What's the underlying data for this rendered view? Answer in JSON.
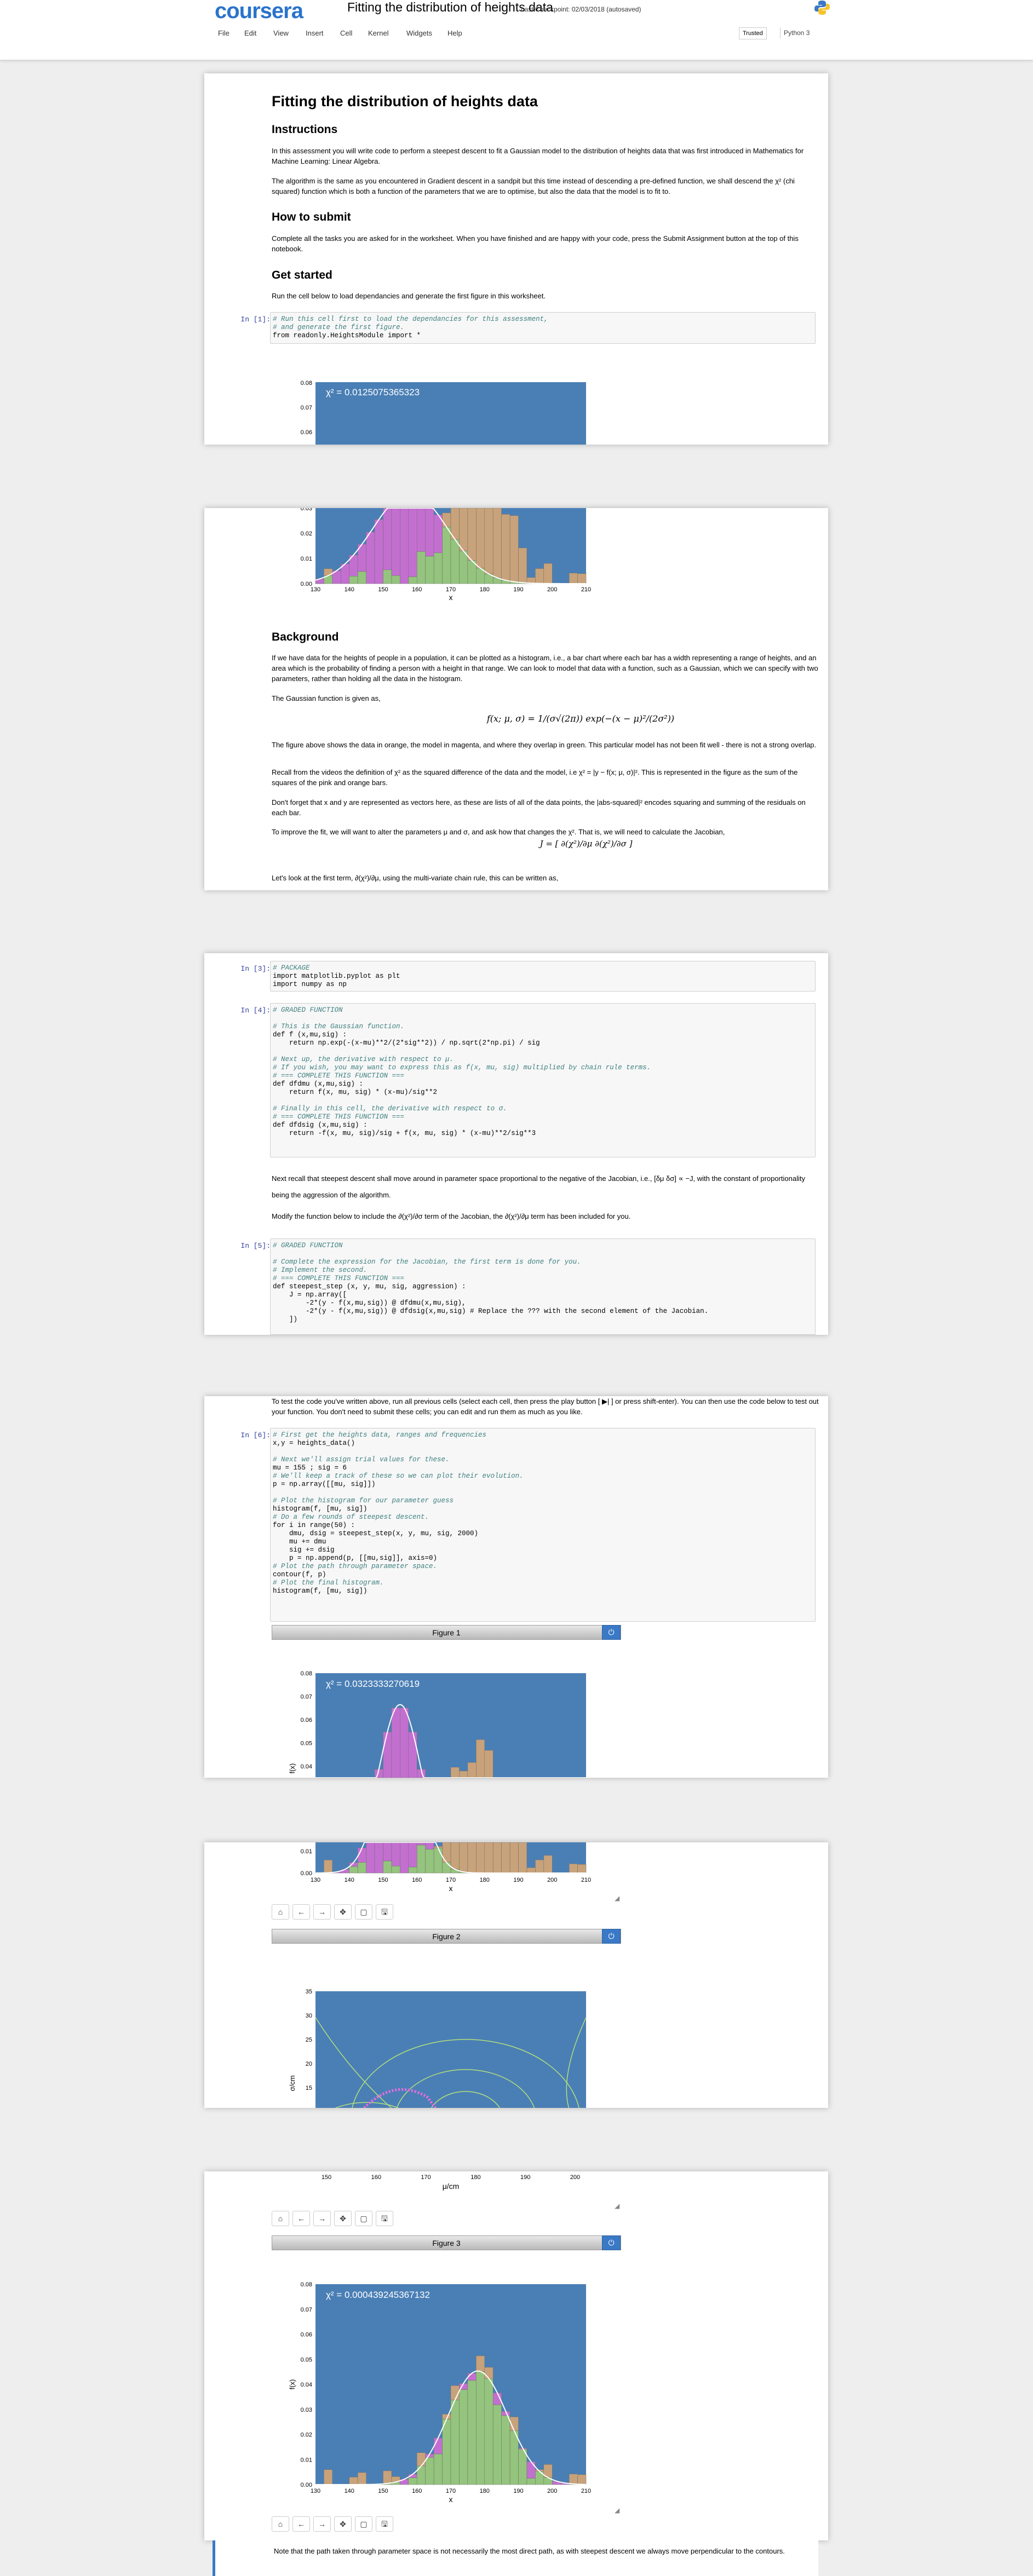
{
  "header": {
    "logo": "coursera",
    "notebook_title": "Fitting the distribution of heights data",
    "checkpoint": "Last Checkpoint: 02/03/2018 (autosaved)",
    "menu": [
      "File",
      "Edit",
      "View",
      "Insert",
      "Cell",
      "Kernel",
      "Widgets",
      "Help"
    ],
    "trusted": "Trusted",
    "kernel": "Python 3"
  },
  "intro": {
    "title": "Fitting the distribution of heights data",
    "h_instructions": "Instructions",
    "p1": "In this assessment you will write code to perform a steepest descent to fit a Gaussian model to the distribution of heights data that was first introduced in Mathematics for Machine Learning: Linear Algebra.",
    "p2": "The algorithm is the same as you encountered in Gradient descent in a sandpit but this time instead of descending a pre-defined function, we shall descend the χ² (chi squared) function which is both a function of the parameters that we are to optimise, but also the data that the model is to fit to.",
    "h_submit": "How to submit",
    "p3": "Complete all the tasks you are asked for in the worksheet. When you have finished and are happy with your code, press the Submit Assignment button at the top of this notebook.",
    "h_started": "Get started",
    "p4": "Run the cell below to load dependancies and generate the first figure in this worksheet.",
    "prompt1": "In [1]:",
    "code1": [
      "# Run this cell first to load the dependancies for this assessment,",
      "# and generate the first figure.",
      "from readonly.HeightsModule import *"
    ]
  },
  "chart1": {
    "chi_label": "χ² = 0.0125075365323",
    "yticks_top": [
      "0.08",
      "0.07",
      "0.06"
    ],
    "yticks_bottom": [
      "0.03",
      "0.02",
      "0.01",
      "0.00"
    ],
    "xticks": [
      "130",
      "140",
      "150",
      "160",
      "170",
      "180",
      "190",
      "200",
      "210"
    ],
    "xlabel": "x"
  },
  "background": {
    "heading": "Background",
    "p1": "If we have data for the heights of people in a population, it can be plotted as a histogram, i.e., a bar chart where each bar has a width representing a range of heights, and an area which is the probability of finding a person with a height in that range. We can look to model that data with a function, such as a Gaussian, which we can specify with two parameters, rather than holding all the data in the histogram.",
    "p2": "The Gaussian function is given as,",
    "formula": "f(x; μ, σ) = 1/(σ√(2π)) exp(−(x − μ)²/(2σ²))",
    "p3": "The figure above shows the data in orange, the model in magenta, and where they overlap in green. This particular model has not been fit well - there is not a strong overlap.",
    "p4": "Recall from the videos the definition of χ² as the squared difference of the data and the model, i.e χ² = |y − f(x; μ, σ)|². This is represented in the figure as the sum of the squares of the pink and orange bars.",
    "p5": "Don't forget that x and y are represented as vectors here, as these are lists of all of the data points, the |abs-squared|² encodes squaring and summing of the residuals on each bar.",
    "p6": "To improve the fit, we will want to alter the parameters μ and σ, and ask how that changes the χ². That is, we will need to calculate the Jacobian,",
    "jacobian": "J = [ ∂(χ²)/∂μ   ∂(χ²)/∂σ ]",
    "p7": "Let's look at the first term, ∂(χ²)/∂μ, using the multi-variate chain rule, this can be written as,"
  },
  "code_section": {
    "prompt3": "In [3]:",
    "code3": [
      "# PACKAGE",
      "import matplotlib.pyplot as plt",
      "import numpy as np"
    ],
    "prompt4": "In [4]:",
    "code4": [
      "# GRADED FUNCTION",
      "",
      "# This is the Gaussian function.",
      "def f (x,mu,sig) :",
      "    return np.exp(-(x-mu)**2/(2*sig**2)) / np.sqrt(2*np.pi) / sig",
      "",
      "# Next up, the derivative with respect to μ.",
      "# If you wish, you may want to express this as f(x, mu, sig) multiplied by chain rule terms.",
      "# === COMPLETE THIS FUNCTION ===",
      "def dfdmu (x,mu,sig) :",
      "    return f(x, mu, sig) * (x-mu)/sig**2",
      "",
      "# Finally in this cell, the derivative with respect to σ.",
      "# === COMPLETE THIS FUNCTION ===",
      "def dfdsig (x,mu,sig) :",
      "    return -f(x, mu, sig)/sig + f(x, mu, sig) * (x-mu)**2/sig**3"
    ],
    "p8": "Next recall that steepest descent shall move around in parameter space proportional to the negative of the Jacobian, i.e., [δμ δσ] ∝ −J, with the constant of proportionality being the aggression of the algorithm.",
    "p9": "Modify the function below to include the ∂(χ²)/∂σ term of the Jacobian, the ∂(χ²)/∂μ term has been included for you.",
    "prompt5": "In [5]:",
    "code5": [
      "# GRADED FUNCTION",
      "",
      "# Complete the expression for the Jacobian, the first term is done for you.",
      "# Implement the second.",
      "# === COMPLETE THIS FUNCTION ===",
      "def steepest_step (x, y, mu, sig, aggression) :",
      "    J = np.array([",
      "        -2*(y - f(x,mu,sig)) @ dfdmu(x,mu,sig),",
      "        -2*(y - f(x,mu,sig)) @ dfdsig(x,mu,sig) # Replace the ??? with the second element of the Jacobian.",
      "    ])"
    ]
  },
  "test_section": {
    "p10": "To test the code you've written above, run all previous cells (select each cell, then press the play button [ ▶| ] or press shift-enter). You can then use the code below to test out your function. You don't need to submit these cells; you can edit and run them as much as you like.",
    "prompt6": "In [6]:",
    "code6": [
      "# First get the heights data, ranges and frequencies",
      "x,y = heights_data()",
      "",
      "# Next we'll assign trial values for these.",
      "mu = 155 ; sig = 6",
      "# We'll keep a track of these so we can plot their evolution.",
      "p = np.array([[mu, sig]])",
      "",
      "# Plot the histogram for our parameter guess",
      "histogram(f, [mu, sig])",
      "# Do a few rounds of steepest descent.",
      "for i in range(50) :",
      "    dmu, dsig = steepest_step(x, y, mu, sig, 2000)",
      "    mu += dmu",
      "    sig += dsig",
      "    p = np.append(p, [[mu,sig]], axis=0)",
      "# Plot the path through parameter space.",
      "contour(f, p)",
      "# Plot the final histogram.",
      "histogram(f, [mu, sig])"
    ]
  },
  "figure1": {
    "bar_label": "Figure 1",
    "chi_label": "χ² = 0.0323333270619",
    "yticks_top": [
      "0.08",
      "0.07",
      "0.06",
      "0.05",
      "0.04"
    ],
    "yticks_bottom": [
      "0.01",
      "0.00"
    ],
    "xticks": [
      "130",
      "140",
      "150",
      "160",
      "170",
      "180",
      "190",
      "200",
      "210"
    ],
    "xlabel": "x",
    "ylabel": "f(x)"
  },
  "figure2": {
    "bar_label": "Figure 2",
    "yticks": [
      "35",
      "30",
      "25",
      "20",
      "15"
    ],
    "ylabel": "σ/cm",
    "xticks": [
      "150",
      "160",
      "170",
      "180",
      "190",
      "200"
    ],
    "xlabel": "μ/cm"
  },
  "figure3": {
    "bar_label": "Figure 3",
    "chi_label": "χ² = 0.000439245367132",
    "yticks": [
      "0.08",
      "0.07",
      "0.06",
      "0.05",
      "0.04",
      "0.03",
      "0.02",
      "0.01",
      "0.00"
    ],
    "xticks": [
      "130",
      "140",
      "150",
      "160",
      "170",
      "180",
      "190",
      "200",
      "210"
    ],
    "xlabel": "x",
    "ylabel": "f(x)"
  },
  "toolbar_icons": [
    "home-icon",
    "back-arrow-icon",
    "forward-arrow-icon",
    "move-icon",
    "zoom-rect-icon",
    "save-icon"
  ],
  "footer_note": "Note that the path taken through parameter space is not necessarily the most direct path, as with steepest descent we always move perpendicular to the contours.",
  "colors": {
    "accent": "#2a73cc",
    "plot_bg": "#4a7fb5",
    "data": "#c8a27a",
    "model": "#c36fd0",
    "overlap": "#94c47d"
  }
}
